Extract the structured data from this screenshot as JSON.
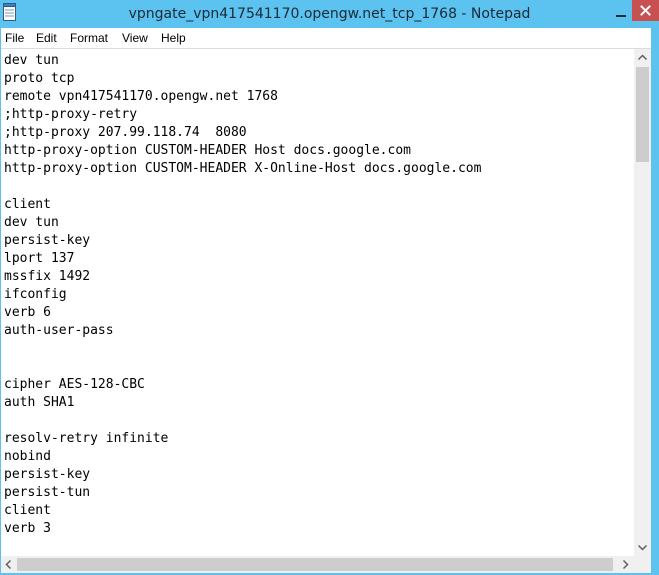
{
  "window": {
    "title": "vpngate_vpn417541170.opengw.net_tcp_1768 - Notepad",
    "accent_color": "#5cc2f0",
    "close_color": "#c75050"
  },
  "icons": {
    "app": "notepad-icon",
    "minimize": "minimize-icon",
    "close": "close-icon",
    "scroll_up": "arrow-up-icon",
    "scroll_down": "arrow-down-icon",
    "scroll_left": "arrow-left-icon",
    "scroll_right": "arrow-right-icon"
  },
  "menu": {
    "file": "File",
    "edit": "Edit",
    "format": "Format",
    "view": "View",
    "help": "Help"
  },
  "editor": {
    "lines": [
      "dev tun",
      "proto tcp",
      "remote vpn417541170.opengw.net 1768",
      ";http-proxy-retry",
      ";http-proxy 207.99.118.74  8080",
      "http-proxy-option CUSTOM-HEADER Host docs.google.com",
      "http-proxy-option CUSTOM-HEADER X-Online-Host docs.google.com",
      "",
      "client",
      "dev tun",
      "persist-key",
      "lport 137",
      "mssfix 1492",
      "ifconfig",
      "verb 6",
      "auth-user-pass",
      "",
      "",
      "cipher AES-128-CBC",
      "auth SHA1",
      "",
      "resolv-retry infinite",
      "nobind",
      "persist-key",
      "persist-tun",
      "client",
      "verb 3"
    ]
  }
}
